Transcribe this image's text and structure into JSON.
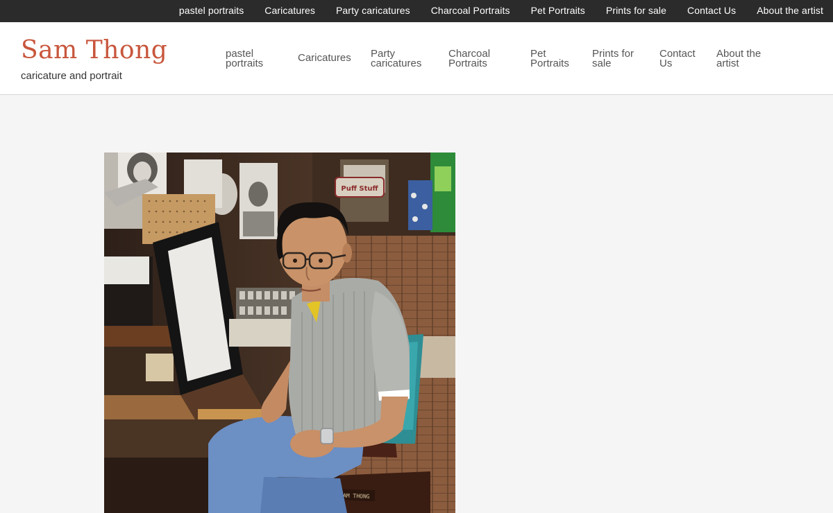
{
  "topnav": {
    "items": [
      {
        "label": "pastel portraits"
      },
      {
        "label": "Caricatures"
      },
      {
        "label": "Party caricatures"
      },
      {
        "label": "Charcoal Portraits"
      },
      {
        "label": "Pet Portraits"
      },
      {
        "label": "Prints for sale"
      },
      {
        "label": "Contact Us"
      },
      {
        "label": "About the artist"
      }
    ]
  },
  "header": {
    "site_title": "Sam Thong",
    "tagline": "caricature and portrait"
  },
  "mainnav": {
    "items": [
      {
        "line1": "pastel",
        "line2": "portraits"
      },
      {
        "line1": "Caricatures",
        "line2": ""
      },
      {
        "line1": "Party",
        "line2": "caricatures"
      },
      {
        "line1": "Charcoal",
        "line2": "Portraits"
      },
      {
        "line1": "Pet",
        "line2": "Portraits"
      },
      {
        "line1": "Prints for",
        "line2": "sale"
      },
      {
        "line1": "Contact",
        "line2": "Us"
      },
      {
        "line1": "About the",
        "line2": "artist"
      }
    ]
  },
  "content": {
    "chair_text": "STOLEN FROM SAM THONG",
    "sign_text": "Puff Stuff"
  },
  "colors": {
    "topbar_bg": "#2b2b2b",
    "title": "#c8563c",
    "page_bg": "#f5f5f5"
  }
}
